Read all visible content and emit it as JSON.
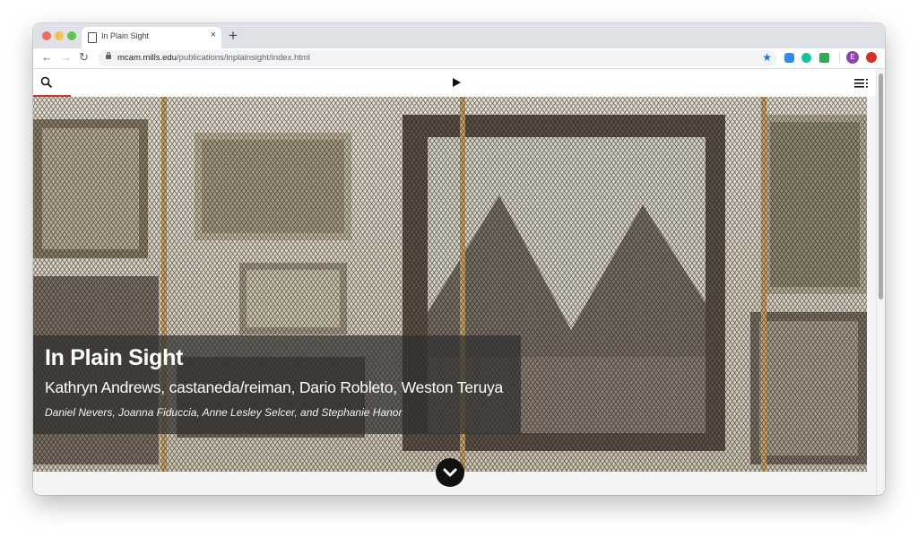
{
  "browser": {
    "tab_title": "In Plain Sight",
    "tab_close": "×",
    "new_tab": "+",
    "url_host": "mcam.mills.edu",
    "url_path": "/publications/inplainsight/index.html",
    "profile_initial": "E",
    "icons": [
      "back-icon",
      "forward-icon",
      "reload-icon",
      "lock-icon",
      "star-icon",
      "zoom-extension-icon",
      "grammarly-extension-icon",
      "extension-icon",
      "avatar",
      "adblock-extension-icon"
    ],
    "colors": {
      "tab_strip": "#dee1e6",
      "accent": "#1a73e8",
      "avatar": "#8e44ad"
    }
  },
  "site": {
    "icons": [
      "search-icon",
      "play-icon",
      "menu-icon"
    ],
    "accent_color": "#c0392b"
  },
  "hero": {
    "title": "In Plain Sight",
    "artists": "Kathryn Andrews, castaneda/reiman, Dario Robleto, Weston Teruya",
    "authors": "Daniel Nevers, Joanna Fiduccia, Anne Lesley Selcer, and Stephanie Hanor",
    "scroll_icon": "chevron-down-icon"
  }
}
